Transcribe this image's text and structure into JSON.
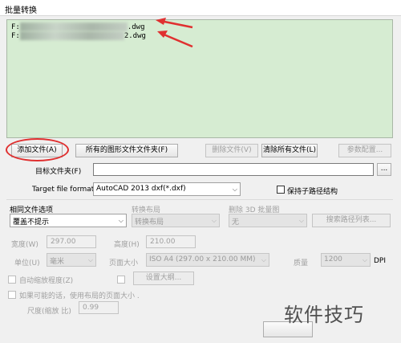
{
  "window": {
    "title": "批量转换"
  },
  "file_list": {
    "items": [
      {
        "prefix": "F:",
        "suffix": ".dwg"
      },
      {
        "prefix": "F:",
        "suffix": "2.dwg"
      }
    ]
  },
  "list_buttons": {
    "add_file": "添加文件(A)",
    "all_drawings_folder": "所有的图形文件文件夹(F)",
    "delete_file": "删除文件(V)",
    "clear_all": "清除所有文件(L)",
    "prefs": "参数配置..."
  },
  "target_folder": {
    "label": "目标文件夹(F)",
    "value": "",
    "browse": "..."
  },
  "target_format": {
    "label": "Target file format",
    "selected": "AutoCAD 2013 dxf(*.dxf)",
    "keep_subfolder_label": "保持子路径结构"
  },
  "same_file": {
    "label": "相同文件选项",
    "selected": "覆盖不提示"
  },
  "convert_layout": {
    "label": "转换布局",
    "selected": "转换布局"
  },
  "ignore_3d": {
    "label": "删除 3D 批量图",
    "selected": "无"
  },
  "search_path_button": "搜索路径列表...",
  "width": {
    "label": "宽度(W)",
    "value": "297.00"
  },
  "height": {
    "label": "高度(H)",
    "value": "210.00"
  },
  "unit": {
    "label": "单位(U)",
    "selected": "毫米"
  },
  "page_size": {
    "label": "页面大小",
    "selected": "ISO A4 (297.00 x 210.00 MM)"
  },
  "quality": {
    "label": "质量",
    "selected": "1200",
    "unit": "DPI"
  },
  "auto_zoom": {
    "label": "自动缩放程度(Z)"
  },
  "settings_button": "设置大纲...",
  "fit_layout": {
    "label": "如果可能的话，使用布局的页面大小 ."
  },
  "size_ratio": {
    "label": "尺度(缩放 比)",
    "value": "0.99"
  },
  "watermark": "软件技巧"
}
